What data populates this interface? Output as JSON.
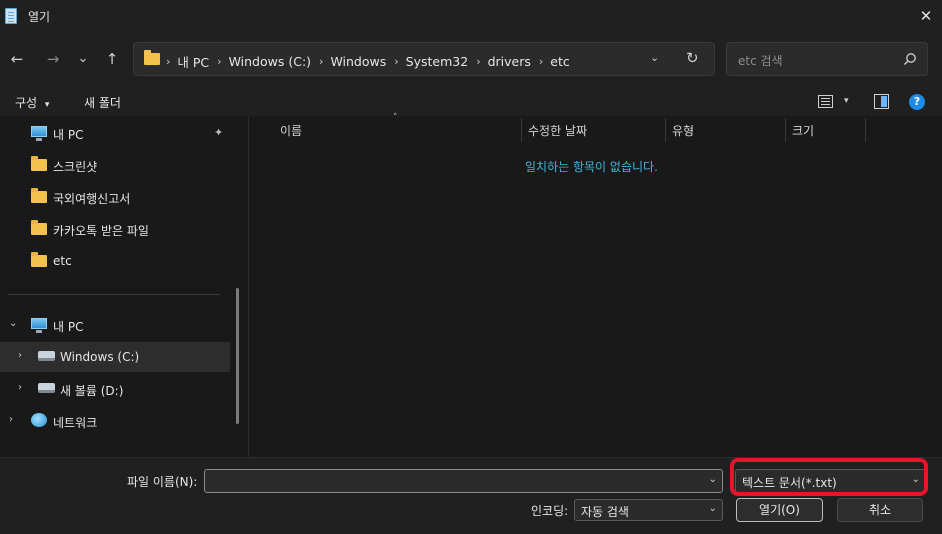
{
  "window": {
    "title": "열기",
    "close_glyph": "✕"
  },
  "nav": {
    "back_glyph": "←",
    "forward_glyph": "→",
    "recent_glyph": "⌄",
    "up_glyph": "↑",
    "breadcrumbs": [
      "내 PC",
      "Windows (C:)",
      "Windows",
      "System32",
      "drivers",
      "etc"
    ],
    "breadcrumb_separator": "›",
    "address_dropdown_glyph": "⌄",
    "refresh_glyph": "↻",
    "search_placeholder": "etc 검색"
  },
  "toolbar": {
    "organize_label": "구성",
    "organize_caret": "▾",
    "new_folder_label": "새 폴더",
    "view_caret": "▾",
    "help_glyph": "?"
  },
  "sidebar": {
    "pin_glyph": "✦",
    "quick_items": [
      {
        "label": "내 PC",
        "icon": "pc-icon"
      },
      {
        "label": "스크린샷",
        "icon": "folder-icon"
      },
      {
        "label": "국외여행신고서",
        "icon": "folder-icon"
      },
      {
        "label": "카카오톡 받은 파일",
        "icon": "folder-icon"
      },
      {
        "label": "etc",
        "icon": "folder-icon"
      }
    ],
    "tree_items": [
      {
        "label": "내 PC",
        "icon": "pc-icon",
        "expander": "⌄"
      },
      {
        "label": "Windows (C:)",
        "icon": "drive-icon",
        "expander": "›",
        "selected": true
      },
      {
        "label": "새 볼륨 (D:)",
        "icon": "drive-icon",
        "expander": "›"
      },
      {
        "label": "네트워크",
        "icon": "network-icon",
        "expander": "›"
      }
    ]
  },
  "file_list": {
    "sort_indicator": "˄",
    "columns": [
      "이름",
      "수정한 날짜",
      "유형",
      "크기"
    ],
    "empty_message": "일치하는 항목이 없습니다."
  },
  "footer": {
    "filename_label": "파일 이름(N):",
    "filename_value": "",
    "filetype_value": "텍스트 문서(*.txt)",
    "encoding_label": "인코딩:",
    "encoding_value": "자동 검색",
    "open_button": "열기(O)",
    "cancel_button": "취소",
    "dropdown_glyph": "⌄"
  },
  "colors": {
    "highlight_annotation": "#e8142a",
    "empty_message": "#3fb6d8",
    "folder": "#f2c14e",
    "help": "#1e8ae6"
  }
}
